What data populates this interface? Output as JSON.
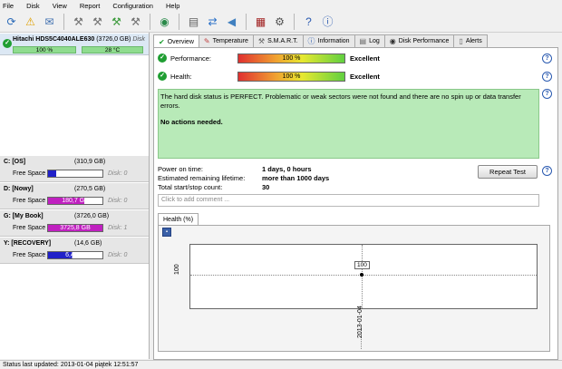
{
  "menu": [
    "File",
    "Disk",
    "View",
    "Report",
    "Configuration",
    "Help"
  ],
  "toolbar": {
    "icons": [
      "refresh-icon",
      "warning-icon",
      "email-icon",
      "disk-tool-icon",
      "disk-tool-icon",
      "disk-tool-icon",
      "disk-tool-icon",
      "globe-icon",
      "report-icon",
      "refresh-blue-icon",
      "speaker-icon",
      "chart-icon",
      "settings-icon",
      "help-icon",
      "info-icon"
    ]
  },
  "disk": {
    "name": "Hitachi HDS5C4040ALE630",
    "size": "(3726,0 GB)",
    "suffix": "Disk",
    "health": "100 %",
    "temperature": "28 °C"
  },
  "volumes": [
    {
      "name": "C: [OS]",
      "size": "(310,9 GB)",
      "free_label": "Free Space",
      "free": "47,8 GB",
      "fill": 0.15,
      "disk": "Disk: 0",
      "color": "#2020c8"
    },
    {
      "name": "D: [Nowy]",
      "size": "(270,5 GB)",
      "free_label": "Free Space",
      "free": "180,7 GB",
      "fill": 0.67,
      "disk": "Disk: 0",
      "color": "#c020c0"
    },
    {
      "name": "G: [My Book]",
      "size": "(3726,0 GB)",
      "free_label": "Free Space",
      "free": "3725,8 GB",
      "fill": 1.0,
      "disk": "Disk: 1",
      "color": "#c020c0"
    },
    {
      "name": "Y: [RECOVERY]",
      "size": "(14,6 GB)",
      "free_label": "Free Space",
      "free": "6,4 GB",
      "fill": 0.44,
      "disk": "Disk: 0",
      "color": "#2020c8"
    }
  ],
  "tabs": [
    "Overview",
    "Temperature",
    "S.M.A.R.T.",
    "Information",
    "Log",
    "Disk Performance",
    "Alerts"
  ],
  "overview": {
    "performance_label": "Performance:",
    "performance_value": "100 %",
    "performance_text": "Excellent",
    "health_label": "Health:",
    "health_value": "100 %",
    "health_text": "Excellent",
    "message": "The hard disk status is PERFECT. Problematic or weak sectors were not found and there are no spin up or data transfer errors.",
    "actions": "No actions needed.",
    "power_on_label": "Power on time:",
    "power_on_value": "1 days, 0 hours",
    "remaining_label": "Estimated remaining lifetime:",
    "remaining_value": "more than 1000 days",
    "startstop_label": "Total start/stop count:",
    "startstop_value": "30",
    "repeat_button": "Repeat Test",
    "comment_placeholder": "Click to add comment ..."
  },
  "health_tab": "Health (%)",
  "chart_data": {
    "type": "line",
    "x": [
      "2013-01-04"
    ],
    "series": [
      {
        "values": [
          100
        ]
      }
    ],
    "y_tick_labels": [
      "100"
    ],
    "point_label": "100"
  },
  "status": "Status last updated: 2013-01-04 piątek 12:51:57"
}
